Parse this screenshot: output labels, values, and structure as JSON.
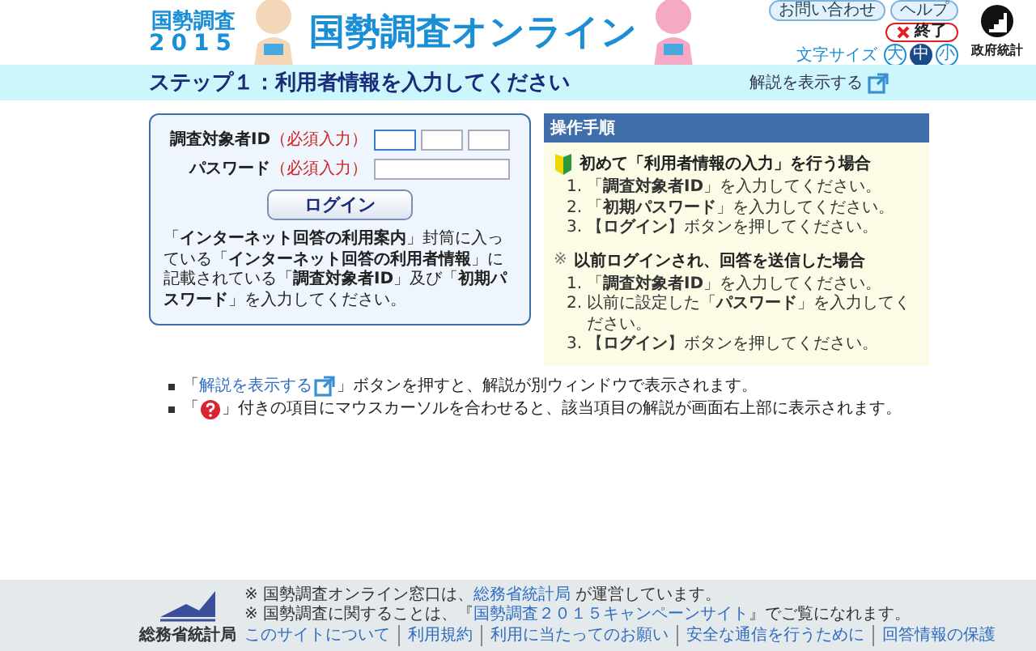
{
  "header": {
    "logo_title": "国勢調査",
    "logo_year": "2015",
    "site_title": "国勢調査オンライン",
    "buttons": [
      {
        "label": "お問い合わせ",
        "kind": "pill"
      },
      {
        "label": "ヘルプ",
        "kind": "pill"
      },
      {
        "label": "終了",
        "kind": "exit"
      }
    ],
    "font_size": {
      "label": "文字サイズ",
      "options": [
        {
          "label": "大",
          "selected": false
        },
        {
          "label": "中",
          "selected": true
        },
        {
          "label": "小",
          "selected": false
        }
      ]
    },
    "stats_mark": "政府統計"
  },
  "step_bar": {
    "title": "ステップ１：利用者情報を入力してください",
    "help_link": "解説を表示する"
  },
  "login": {
    "fields": [
      {
        "label": "調査対象者ID",
        "required": "（必須入力）",
        "kind": "split"
      },
      {
        "label": "パスワード",
        "required": "（必須入力）",
        "kind": "single"
      }
    ],
    "button": "ログイン",
    "note": "「**インターネット回答の利用案内**」封筒に入っている「**インターネット回答の利用者情報**」に記載されている「**調査対象者ID**」及び「**初期パスワード**」を入力してください。"
  },
  "procedure": {
    "title": "操作手順",
    "sections": [
      {
        "kind": "beginner",
        "heading": "初めて「利用者情報の入力」を行う場合",
        "steps": [
          {
            "number": "1.",
            "text": "「**調査対象者ID**」を入力してください。"
          },
          {
            "number": "2.",
            "text": "「**初期パスワード**」を入力してください。"
          },
          {
            "number": "3.",
            "text": "【**ログイン**】ボタンを押してください。"
          }
        ]
      },
      {
        "kind": "note",
        "mark": "※",
        "heading": "以前ログインされ、回答を送信した場合",
        "steps": [
          {
            "number": "1.",
            "text": "「**調査対象者ID**」を入力してください。"
          },
          {
            "number": "2.",
            "text": "以前に設定した「**パスワード**」を入力してください。"
          },
          {
            "number": "3.",
            "text": "【**ログイン**】ボタンを押してください。"
          }
        ]
      }
    ]
  },
  "notes": [
    {
      "kind": "link",
      "before": "「",
      "link": "解説を表示する",
      "after": "」ボタンを押すと、解説が別ウィンドウで表示されます。"
    },
    {
      "kind": "help",
      "before": "「",
      "after": "」付きの項目にマウスカーソルを合わせると、該当項目の解説が画面右上部に表示されます。"
    }
  ],
  "footer": {
    "org": "総務省統計局",
    "notes": [
      {
        "mark": "※",
        "before": "国勢調査オンライン窓口は、",
        "link": "総務省統計局",
        "after": " が運営しています。"
      },
      {
        "mark": "※",
        "before": "国勢調査に関することは、『",
        "link": "国勢調査２０１５キャンペーンサイト",
        "after": "』でご覧になれます。"
      }
    ],
    "links": [
      "このサイトについて",
      "利用規約",
      "利用に当たってのお願い",
      "安全な通信を行うために",
      "回答情報の保護"
    ]
  }
}
